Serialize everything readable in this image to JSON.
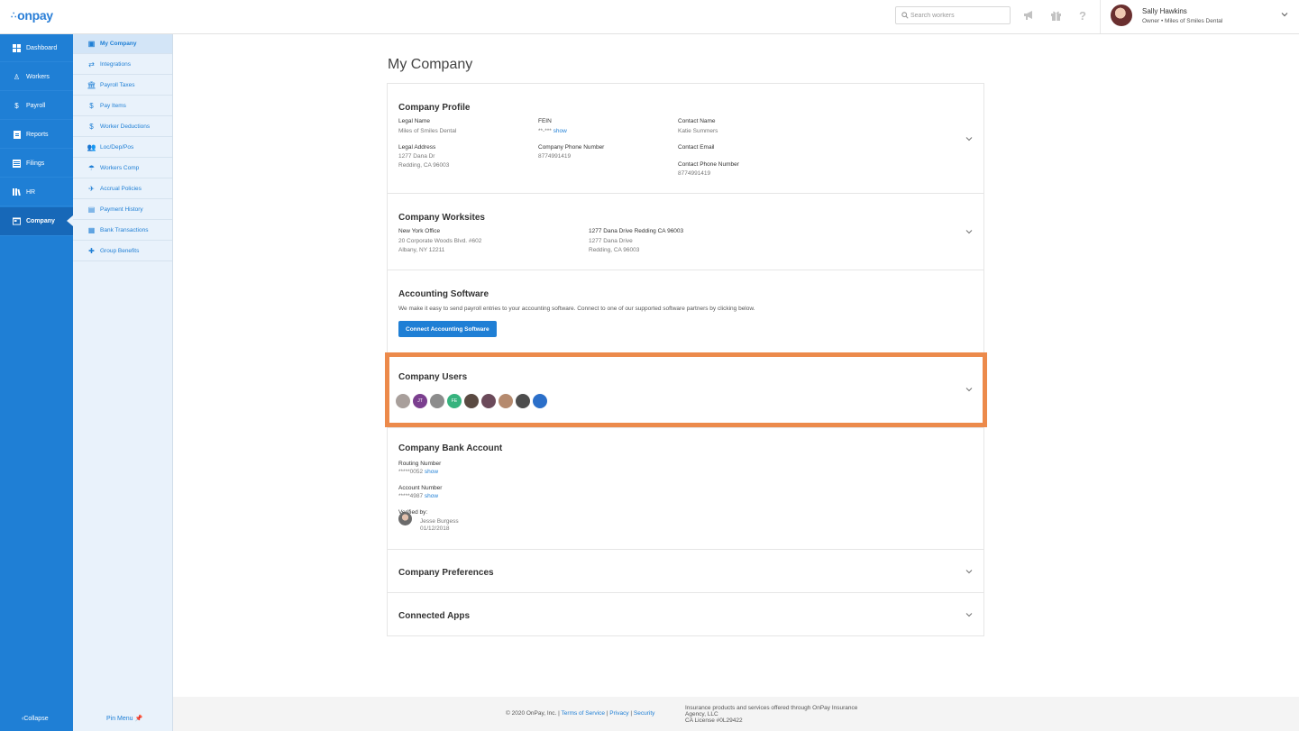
{
  "header": {
    "logo": "onpay",
    "search_placeholder": "Search workers",
    "user_name": "Sally Hawkins",
    "user_role": "Owner • Miles of Smiles Dental"
  },
  "nav": {
    "items": [
      {
        "label": "Dashboard",
        "icon": "dashboard-icon"
      },
      {
        "label": "Workers",
        "icon": "workers-icon"
      },
      {
        "label": "Payroll",
        "icon": "payroll-icon"
      },
      {
        "label": "Reports",
        "icon": "reports-icon"
      },
      {
        "label": "Filings",
        "icon": "filings-icon"
      },
      {
        "label": "HR",
        "icon": "hr-icon"
      },
      {
        "label": "Company",
        "icon": "company-icon"
      }
    ],
    "collapse": "Collapse"
  },
  "subnav": {
    "items": [
      {
        "label": "My Company"
      },
      {
        "label": "Integrations"
      },
      {
        "label": "Payroll Taxes"
      },
      {
        "label": "Pay Items"
      },
      {
        "label": "Worker Deductions"
      },
      {
        "label": "Loc/Dep/Pos"
      },
      {
        "label": "Workers Comp"
      },
      {
        "label": "Accrual Policies"
      },
      {
        "label": "Payment History"
      },
      {
        "label": "Bank Transactions"
      },
      {
        "label": "Group Benefits"
      }
    ],
    "pin_menu": "Pin Menu"
  },
  "page": {
    "title": "My Company",
    "profile": {
      "title": "Company Profile",
      "legal_name_label": "Legal Name",
      "legal_name": "Miles of Smiles Dental",
      "legal_address_label": "Legal Address",
      "legal_address_1": "1277 Dana Dr",
      "legal_address_2": "Redding, CA 96003",
      "fein_label": "FEIN",
      "fein": "**-***",
      "show": "show",
      "phone_label": "Company Phone Number",
      "phone": "8774991419",
      "contact_name_label": "Contact Name",
      "contact_name": "Katie Summers",
      "contact_email_label": "Contact Email",
      "contact_phone_label": "Contact Phone Number",
      "contact_phone": "8774991419"
    },
    "worksites": {
      "title": "Company Worksites",
      "site1_name": "New York Office",
      "site1_line1": "20 Corporate Woods Blvd. #602",
      "site1_line2": "Albany, NY 12211",
      "site2_name": "1277 Dana Drive Redding CA 96003",
      "site2_line1": "1277 Dana Drive",
      "site2_line2": "Redding, CA 96003"
    },
    "accounting": {
      "title": "Accounting Software",
      "description": "We make it easy to send payroll entries to your accounting software. Connect to one of our supported software partners by clicking below.",
      "button": "Connect Accounting Software"
    },
    "users": {
      "title": "Company Users",
      "avatars": [
        {
          "initials": "",
          "color": "#a89f9b"
        },
        {
          "initials": "JT",
          "color": "#7b3f8f"
        },
        {
          "initials": "",
          "color": "#8c8c8c"
        },
        {
          "initials": "FE",
          "color": "#36b37e"
        },
        {
          "initials": "",
          "color": "#5a4a42"
        },
        {
          "initials": "",
          "color": "#6b4a5a"
        },
        {
          "initials": "",
          "color": "#b58a6e"
        },
        {
          "initials": "",
          "color": "#4d4d4d"
        },
        {
          "initials": "",
          "color": "#2b6fc9"
        }
      ]
    },
    "bank": {
      "title": "Company Bank Account",
      "routing_label": "Routing Number",
      "routing": "*****0052",
      "account_label": "Account Number",
      "account": "*****4987",
      "show": "show",
      "verified_label": "Verified by:",
      "verified_name": "Jesse Burgess",
      "verified_date": "01/12/2018"
    },
    "preferences": {
      "title": "Company Preferences"
    },
    "apps": {
      "title": "Connected Apps"
    }
  },
  "footer": {
    "copyright": "© 2020 OnPay, Inc. |",
    "terms": "Terms of Service",
    "privacy": "Privacy",
    "security": "Security",
    "sep": "|",
    "insurance_1": "Insurance products and services offered through OnPay Insurance",
    "insurance_2": "Agency, LLC",
    "insurance_3": "CA License #0L29422"
  },
  "colors": {
    "brand": "#1f7fd5",
    "highlight": "#ec8a4b"
  }
}
